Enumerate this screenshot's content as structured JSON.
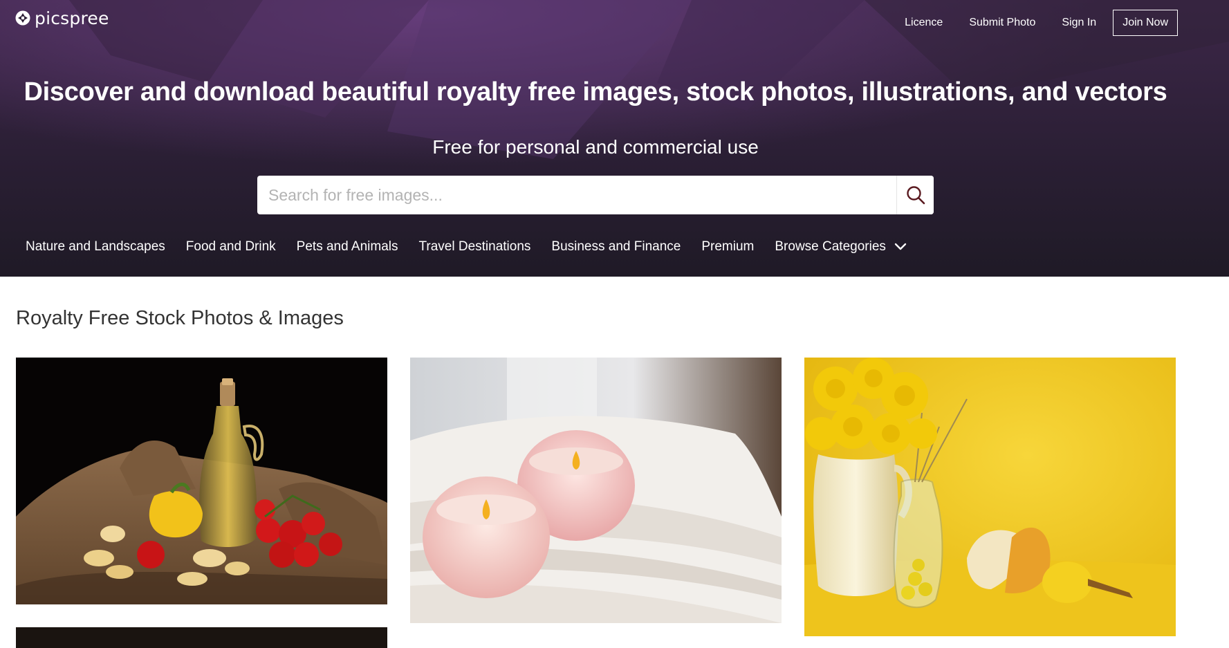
{
  "brand": {
    "name": "picspree"
  },
  "header": {
    "nav": {
      "licence": "Licence",
      "submit_photo": "Submit Photo",
      "sign_in": "Sign In",
      "join_now": "Join Now"
    }
  },
  "hero": {
    "headline": "Discover and download beautiful royalty free images, stock photos, illustrations, and vectors",
    "subheadline": "Free for personal and commercial use",
    "search": {
      "placeholder": "Search for free images...",
      "value": "",
      "button_icon": "search-icon"
    },
    "categories": [
      "Nature and Landscapes",
      "Food and Drink",
      "Pets and Animals",
      "Travel Destinations",
      "Business and Finance",
      "Premium"
    ],
    "browse_categories": "Browse Categories"
  },
  "main": {
    "section_title": "Royalty Free Stock Photos & Images",
    "photos": [
      "olive-oil-vegetables-photo",
      "candles-on-towels-photo",
      "yellow-flowers-still-life-photo",
      "dark-photo"
    ]
  },
  "colors": {
    "hero_dark": "#2a1c33",
    "hero_purple": "#5b3a6e",
    "text_dark": "#333333",
    "white": "#ffffff"
  }
}
